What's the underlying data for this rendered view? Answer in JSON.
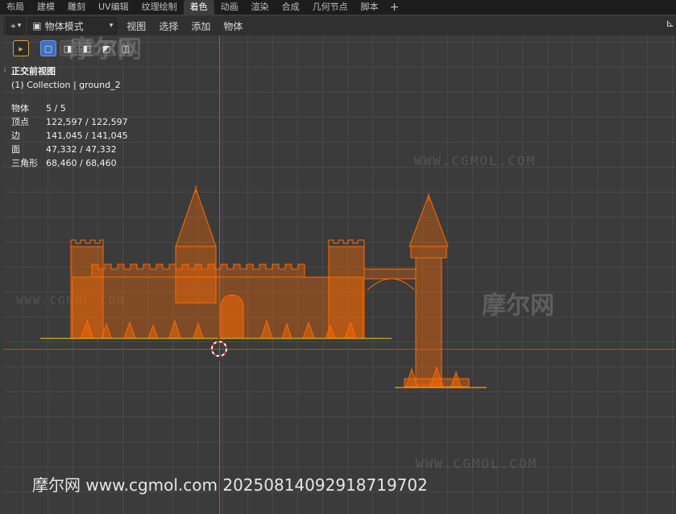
{
  "topbar": {
    "tabs": [
      "布局",
      "建模",
      "雕刻",
      "UV编辑",
      "纹理绘制",
      "着色",
      "动画",
      "渲染",
      "合成",
      "几何节点",
      "脚本"
    ],
    "active_index": 5,
    "add_icon": "plus-icon"
  },
  "header": {
    "editor_icon": "viewport-editor-icon",
    "mode": "物体模式",
    "menus": [
      "视图",
      "选择",
      "添加",
      "物体"
    ]
  },
  "overlay": {
    "view_title": "正交前视图",
    "collection": "(1) Collection | ground_2",
    "stats": [
      {
        "label": "物体",
        "value": "5 / 5"
      },
      {
        "label": "顶点",
        "value": "122,597 / 122,597"
      },
      {
        "label": "边",
        "value": "141,045 / 141,045"
      },
      {
        "label": "面",
        "value": "47,332 / 47,332"
      },
      {
        "label": "三角形",
        "value": "68,460 / 68,460"
      }
    ]
  },
  "watermarks": {
    "site": "WWW.CGMOL.COM",
    "brand": "摩尔网",
    "footer": "摩尔网 www.cgmol.com 20250814092918719702"
  },
  "colors": {
    "selection_orange": "#ff6a00",
    "x_axis": "#b34747",
    "z_axis": "#4a6fb3"
  }
}
